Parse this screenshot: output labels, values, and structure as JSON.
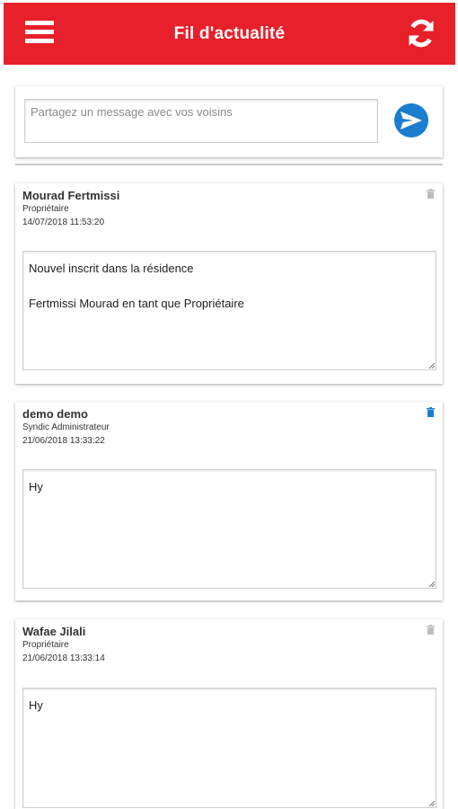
{
  "header": {
    "title": "Fil d'actualité",
    "menu_icon": "hamburger-menu-icon",
    "refresh_icon": "refresh-icon",
    "background_color": "#e8202a"
  },
  "composer": {
    "placeholder": "Partagez un message avec vos voisins",
    "value": "",
    "send_icon": "send-arrow-icon",
    "send_color": "#1a7dd0"
  },
  "posts": [
    {
      "author": "Mourad Fertmissi",
      "role": "Propriétaire",
      "date": "14/07/2018 11:53:20",
      "content_line_1": "Nouvel inscrit dans la résidence",
      "content_line_2": "Fertmissi Mourad en tant que Propriétaire",
      "delete_icon": "trash-icon",
      "delete_icon_color": "#bdbdbd"
    },
    {
      "author": "demo demo",
      "role": "Syndic Administrateur",
      "date": "21/06/2018 13:33:22",
      "content_line_1": "Hy",
      "delete_icon": "trash-icon",
      "delete_icon_color": "#1a7dd0"
    },
    {
      "author": "Wafae Jilali",
      "role": "Propriétaire",
      "date": "21/06/2018 13:33:14",
      "content_line_1": "Hy",
      "delete_icon": "trash-icon",
      "delete_icon_color": "#bdbdbd"
    }
  ]
}
